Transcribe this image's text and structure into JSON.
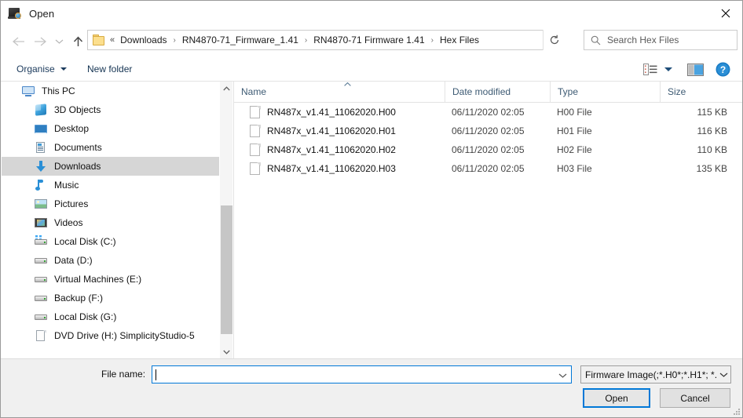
{
  "window": {
    "title": "Open",
    "title_icon": "open-folder-monitor-icon",
    "close_label": "close-icon"
  },
  "nav": {
    "back_icon": "arrow-left-icon",
    "forward_icon": "arrow-right-icon",
    "recent_icon": "chevron-down-icon",
    "up_icon": "arrow-up-icon",
    "refresh_icon": "refresh-icon",
    "address_dropdown_icon": "chevron-down-icon"
  },
  "address": {
    "folder_icon": "folder-icon",
    "overflow": "«",
    "separator": "›",
    "crumbs": [
      "Downloads",
      "RN4870-71_Firmware_1.41",
      "RN4870-71 Firmware 1.41",
      "Hex Files"
    ]
  },
  "search": {
    "icon": "search-icon",
    "placeholder": "Search Hex Files",
    "value": ""
  },
  "toolbar": {
    "organise_label": "Organise",
    "new_folder_label": "New folder",
    "view_icon": "view-layout-icon",
    "preview_pane_icon": "preview-pane-icon",
    "help_icon": "help-icon"
  },
  "sidebar": {
    "items": [
      {
        "label": "This PC",
        "icon": "pc-icon",
        "level": 0,
        "selected": false
      },
      {
        "label": "3D Objects",
        "icon": "3d-objects-icon",
        "level": 1,
        "selected": false
      },
      {
        "label": "Desktop",
        "icon": "desktop-icon",
        "level": 1,
        "selected": false
      },
      {
        "label": "Documents",
        "icon": "documents-icon",
        "level": 1,
        "selected": false
      },
      {
        "label": "Downloads",
        "icon": "downloads-icon",
        "level": 1,
        "selected": true
      },
      {
        "label": "Music",
        "icon": "music-icon",
        "level": 1,
        "selected": false
      },
      {
        "label": "Pictures",
        "icon": "pictures-icon",
        "level": 1,
        "selected": false
      },
      {
        "label": "Videos",
        "icon": "videos-icon",
        "level": 1,
        "selected": false
      },
      {
        "label": "Local Disk (C:)",
        "icon": "system-drive-icon",
        "level": 1,
        "selected": false
      },
      {
        "label": "Data (D:)",
        "icon": "drive-icon",
        "level": 1,
        "selected": false
      },
      {
        "label": "Virtual Machines (E:)",
        "icon": "drive-icon",
        "level": 1,
        "selected": false
      },
      {
        "label": "Backup (F:)",
        "icon": "drive-icon",
        "level": 1,
        "selected": false
      },
      {
        "label": "Local Disk (G:)",
        "icon": "drive-icon",
        "level": 1,
        "selected": false
      },
      {
        "label": "DVD Drive (H:) SimplicityStudio-5",
        "icon": "dvd-drive-icon",
        "level": 1,
        "selected": false
      }
    ]
  },
  "filelist": {
    "sort_column": "Name",
    "sort_direction": "ascending",
    "columns": [
      {
        "label": "Name",
        "key": "name"
      },
      {
        "label": "Date modified",
        "key": "date"
      },
      {
        "label": "Type",
        "key": "type"
      },
      {
        "label": "Size",
        "key": "size"
      }
    ],
    "rows": [
      {
        "name": "RN487x_v1.41_11062020.H00",
        "date": "06/11/2020 02:05",
        "type": "H00 File",
        "size": "115 KB",
        "icon": "file-icon"
      },
      {
        "name": "RN487x_v1.41_11062020.H01",
        "date": "06/11/2020 02:05",
        "type": "H01 File",
        "size": "116 KB",
        "icon": "file-icon"
      },
      {
        "name": "RN487x_v1.41_11062020.H02",
        "date": "06/11/2020 02:05",
        "type": "H02 File",
        "size": "110 KB",
        "icon": "file-icon"
      },
      {
        "name": "RN487x_v1.41_11062020.H03",
        "date": "06/11/2020 02:05",
        "type": "H03 File",
        "size": "135 KB",
        "icon": "file-icon"
      }
    ]
  },
  "footer": {
    "file_name_label": "File name:",
    "file_name_value": "",
    "file_name_dropdown_icon": "chevron-down-icon",
    "filter_value": "Firmware Image(;*.H0*;*.H1*; *.",
    "filter_dropdown_icon": "chevron-down-icon",
    "open_label": "Open",
    "cancel_label": "Cancel",
    "resize_grip_icon": "resize-grip-icon"
  },
  "colors": {
    "accent": "#0078d7",
    "selection": "#d6d6d6",
    "header_text": "#3d5a73",
    "footer_bg": "#f0f0f0"
  }
}
